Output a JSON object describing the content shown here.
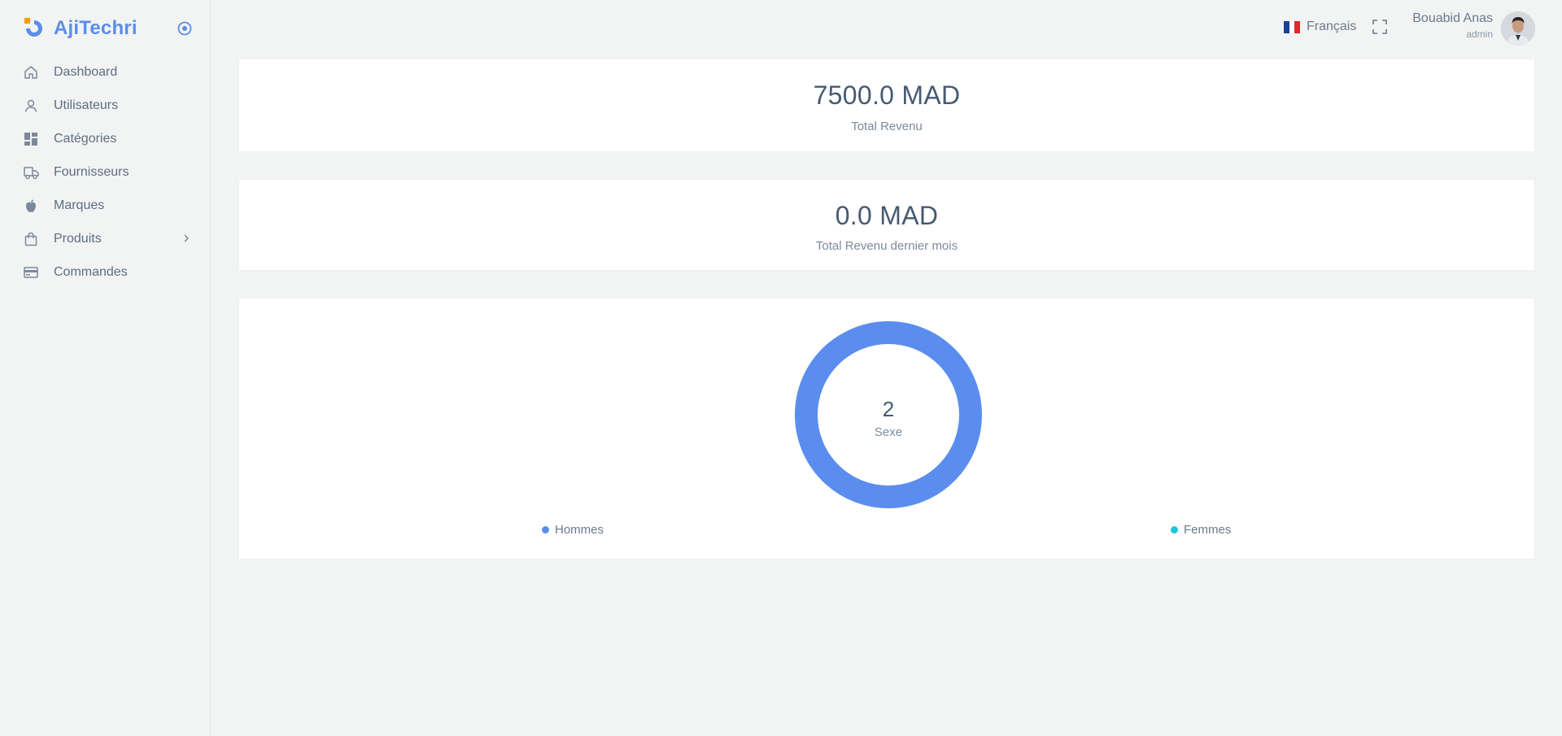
{
  "app": {
    "name": "AjiTechri"
  },
  "sidebar": {
    "items": [
      {
        "label": "Dashboard",
        "icon": "home-icon"
      },
      {
        "label": "Utilisateurs",
        "icon": "user-icon"
      },
      {
        "label": "Catégories",
        "icon": "grid-icon"
      },
      {
        "label": "Fournisseurs",
        "icon": "truck-icon"
      },
      {
        "label": "Marques",
        "icon": "apple-icon"
      },
      {
        "label": "Produits",
        "icon": "shopping-bag-icon",
        "has_submenu": true
      },
      {
        "label": "Commandes",
        "icon": "credit-card-icon"
      }
    ]
  },
  "topbar": {
    "language": "Français",
    "user": {
      "name": "Bouabid Anas",
      "role": "admin"
    }
  },
  "stats": {
    "total_revenue": {
      "value": "7500.0 MAD",
      "label": "Total Revenu"
    },
    "last_month_revenue": {
      "value": "0.0 MAD",
      "label": "Total Revenu dernier mois"
    }
  },
  "chart_data": {
    "type": "pie",
    "center_value": "2",
    "center_label": "Sexe",
    "categories": [
      "Hommes",
      "Femmes"
    ],
    "values": [
      2,
      0
    ],
    "colors": [
      "#5b8def",
      "#1ec6d9"
    ],
    "legend": "bottom"
  },
  "colors": {
    "accent": "#5a8ee8",
    "logo_orange": "#f59e0b",
    "text": "#5d6e82"
  }
}
